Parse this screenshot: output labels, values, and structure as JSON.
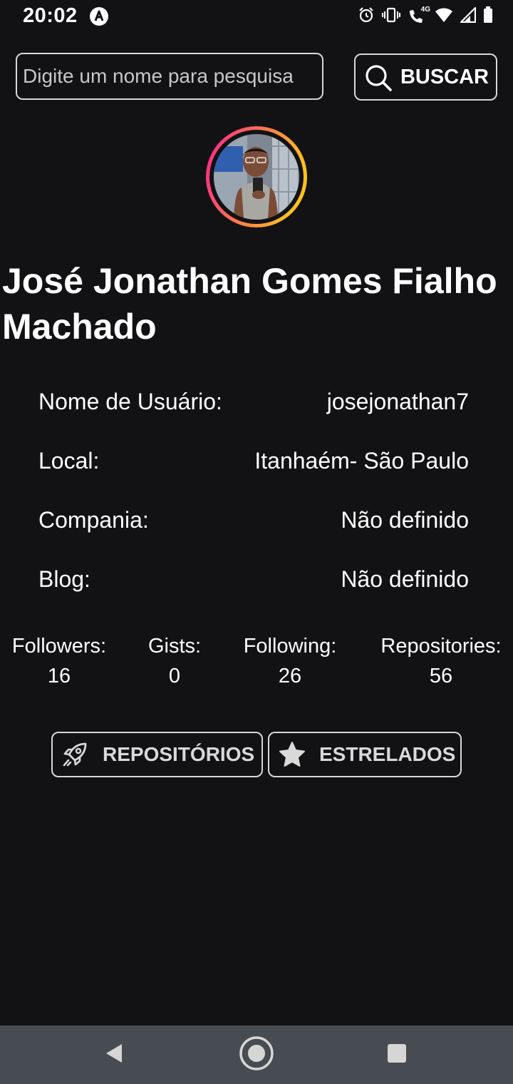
{
  "status_bar": {
    "time": "20:02",
    "app_icon": "notification-app-icon",
    "icons": [
      "alarm-icon",
      "vibrate-icon",
      "wifi-calling-4g-icon",
      "wifi-icon",
      "signal-icon",
      "battery-icon"
    ],
    "network_label": "4G"
  },
  "search": {
    "placeholder": "Digite um nome para pesquisa",
    "value": "",
    "button_label": "BUSCAR",
    "button_icon": "search-icon"
  },
  "profile": {
    "avatar_icon": "avatar-photo",
    "name": "José Jonathan Gomes Fialho Machado",
    "info": [
      {
        "label": "Nome de Usuário:",
        "value": "josejonathan7"
      },
      {
        "label": "Local:",
        "value": "Itanhaém- São Paulo"
      },
      {
        "label": "Compania:",
        "value": "Não definido"
      },
      {
        "label": "Blog:",
        "value": "Não definido"
      }
    ],
    "stats": [
      {
        "label": "Followers:",
        "value": "16"
      },
      {
        "label": "Gists:",
        "value": "0"
      },
      {
        "label": "Following:",
        "value": "26"
      },
      {
        "label": "Repositories:",
        "value": "56"
      }
    ]
  },
  "actions": {
    "repos_label": "REPOSITÓRIOS",
    "repos_icon": "rocket-icon",
    "starred_label": "ESTRELADOS",
    "starred_icon": "star-icon"
  },
  "nav": {
    "icons": [
      "back-icon",
      "home-icon",
      "recents-icon"
    ]
  },
  "colors": {
    "background": "#121214",
    "border": "#d8d8d8",
    "nav_bar": "#474b52",
    "avatar_ring_start": "#ff1f8f",
    "avatar_ring_end": "#ffc21a"
  }
}
